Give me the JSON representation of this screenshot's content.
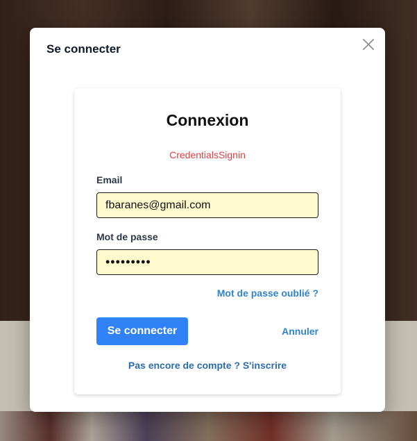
{
  "modal": {
    "title": "Se connecter"
  },
  "login_form": {
    "heading": "Connexion",
    "error": "CredentialsSignin",
    "email_label": "Email",
    "email_value": "fbaranes@gmail.com",
    "password_label": "Mot de passe",
    "password_value": "•••••••••",
    "forgot_password": "Mot de passe oublié ?",
    "submit_label": "Se connecter",
    "cancel_label": "Annuler",
    "signup_link": "Pas encore de compte ? S'inscrire"
  },
  "icons": {
    "close": "close-icon"
  },
  "colors": {
    "primary": "#3182f6",
    "link": "#3182ce",
    "error": "#e53e3e",
    "input_autofill": "#fffacd"
  }
}
